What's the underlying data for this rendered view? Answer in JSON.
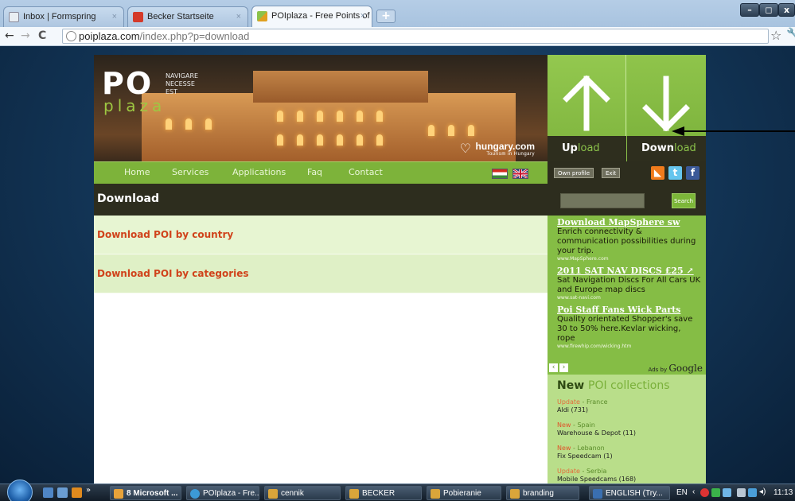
{
  "browser": {
    "tabs": [
      {
        "title": "Inbox | Formspring",
        "active": false
      },
      {
        "title": "Becker Startseite",
        "active": false
      },
      {
        "title": "POIplaza - Free Points of ...",
        "active": true
      }
    ],
    "tab_close": "×",
    "new_tab": "+",
    "url_host": "poiplaza.com",
    "url_path": "/index.php?p=download",
    "nav": {
      "back": "←",
      "forward": "→",
      "reload": "C",
      "star": "☆"
    },
    "window_controls": [
      "–",
      "◻",
      "x"
    ]
  },
  "site": {
    "logo": {
      "po": "PO",
      "plaza": "plaza",
      "motto": [
        "NAVIGARE",
        "NECESSE",
        "EST"
      ]
    },
    "sponsor": {
      "name": "hungary.com",
      "tagline": "Tourism in Hungary",
      "icon": "heart-icon"
    },
    "upload": {
      "label_bold": "Up",
      "label_light": "load"
    },
    "download": {
      "label_bold": "Down",
      "label_light": "load"
    },
    "menu": [
      "Home",
      "Services",
      "Applications",
      "Faq",
      "Contact"
    ],
    "flags": [
      "hungary-flag-icon",
      "uk-flag-icon"
    ],
    "user_buttons": {
      "profile": "Own profile",
      "exit": "Exit"
    },
    "social": [
      "rss-icon",
      "twitter-icon",
      "facebook-icon"
    ],
    "page_title": "Download",
    "search_button": "Search",
    "download_links": [
      "Download POI by country",
      "Download POI by categories"
    ],
    "ads": [
      {
        "title": "Download MapSphere sw",
        "text": "Enrich connectivity & communication possibilities during your trip.",
        "url": "www.MapSphere.com"
      },
      {
        "title": "2011 SAT NAV DISCS £25",
        "text": "Sat Navigation Discs For All Cars UK and Europe map discs",
        "url": "www.sat-navi.com"
      },
      {
        "title": "Poi Staff Fans Wick Parts",
        "text": "Quality orientated Shopper's save 30 to 50% here.Kevlar wicking, rope",
        "url": "www.firewhip.com/wicking.htm"
      }
    ],
    "ads_by": "Ads by",
    "ads_brand": "Google",
    "collections": {
      "title_bold": "New",
      "title_light": "POI collections",
      "items": [
        {
          "tag": "Update",
          "country": "France",
          "name": "Aldi (731)"
        },
        {
          "tag": "New",
          "country": "Spain",
          "name": "Warehouse & Depot (11)"
        },
        {
          "tag": "New",
          "country": "Lebanon",
          "name": "Fix Speedcam (1)"
        },
        {
          "tag": "Update",
          "country": "Serbia",
          "name": "Mobile Speedcams (168)"
        }
      ]
    }
  },
  "taskbar": {
    "tasks": [
      "8 Microsoft ...",
      "POIplaza - Fre...",
      "cennik",
      "BECKER",
      "Pobieranie",
      "branding",
      "ENGLISH (Try..."
    ],
    "language": "EN",
    "clock": "11:13"
  },
  "colors": {
    "brand_green": "#8bc24a",
    "dark_bar": "#2d2d1e",
    "link_orange": "#d0431b"
  }
}
